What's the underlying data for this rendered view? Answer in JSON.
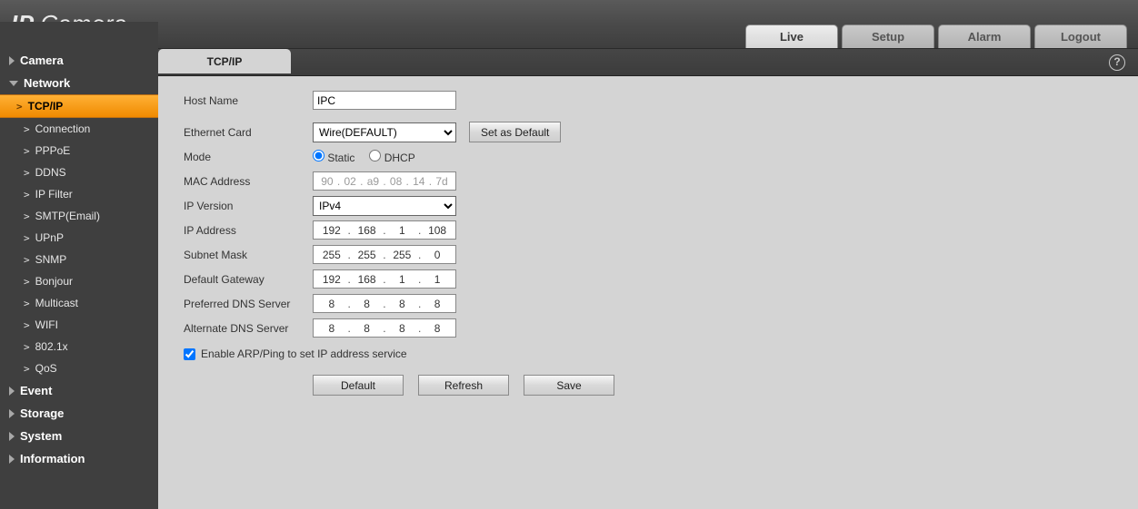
{
  "logo_prefix": "IP",
  "logo_suffix": "Camera",
  "header_tabs": {
    "live": "Live",
    "setup": "Setup",
    "alarm": "Alarm",
    "logout": "Logout"
  },
  "help_glyph": "?",
  "sidebar": {
    "camera": "Camera",
    "network": "Network",
    "network_items": {
      "tcpip": "TCP/IP",
      "connection": "Connection",
      "pppoe": "PPPoE",
      "ddns": "DDNS",
      "ipfilter": "IP Filter",
      "smtp": "SMTP(Email)",
      "upnp": "UPnP",
      "snmp": "SNMP",
      "bonjour": "Bonjour",
      "multicast": "Multicast",
      "wifi": "WIFI",
      "8021x": "802.1x",
      "qos": "QoS"
    },
    "event": "Event",
    "storage": "Storage",
    "system": "System",
    "information": "Information"
  },
  "page_tab": "TCP/IP",
  "labels": {
    "host_name": "Host Name",
    "ethernet_card": "Ethernet Card",
    "mode": "Mode",
    "mac": "MAC Address",
    "ip_version": "IP Version",
    "ip_address": "IP Address",
    "subnet": "Subnet Mask",
    "gateway": "Default Gateway",
    "dns1": "Preferred DNS Server",
    "dns2": "Alternate DNS Server",
    "arp": "Enable ARP/Ping to set IP address service"
  },
  "values": {
    "host_name": "IPC",
    "ethernet_card": "Wire(DEFAULT)",
    "mode_static": "Static",
    "mode_dhcp": "DHCP",
    "mac": {
      "a": "90",
      "b": "02",
      "c": "a9",
      "d": "08",
      "e": "14",
      "f": "7d"
    },
    "ip_version": "IPv4",
    "ip": {
      "a": "192",
      "b": "168",
      "c": "1",
      "d": "108"
    },
    "mask": {
      "a": "255",
      "b": "255",
      "c": "255",
      "d": "0"
    },
    "gw": {
      "a": "192",
      "b": "168",
      "c": "1",
      "d": "1"
    },
    "dns1": {
      "a": "8",
      "b": "8",
      "c": "8",
      "d": "8"
    },
    "dns2": {
      "a": "8",
      "b": "8",
      "c": "8",
      "d": "8"
    }
  },
  "buttons": {
    "set_default": "Set as Default",
    "default": "Default",
    "refresh": "Refresh",
    "save": "Save"
  }
}
